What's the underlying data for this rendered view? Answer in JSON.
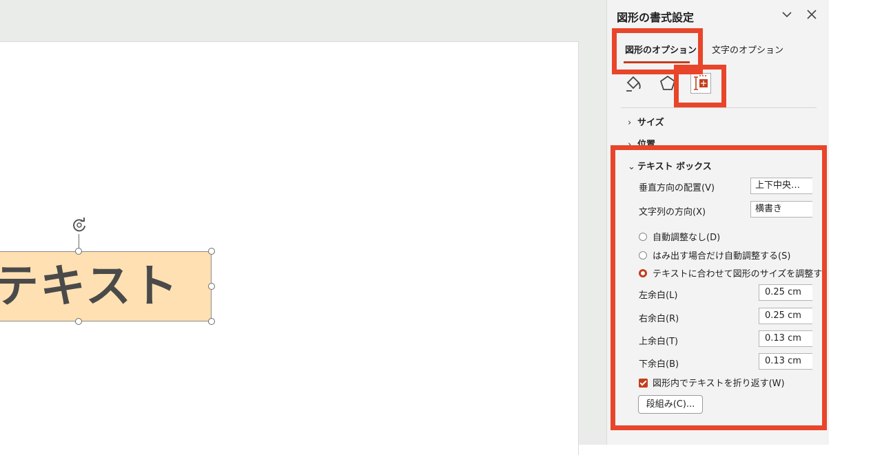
{
  "canvas": {
    "shape_text": "テキスト"
  },
  "panel": {
    "title": "図形の書式設定",
    "tabs": [
      {
        "label": "図形のオプション",
        "active": true
      },
      {
        "label": "文字のオプション",
        "active": false
      }
    ],
    "category_icons": [
      "fill-line-icon",
      "effects-pentagon-icon",
      "size-properties-icon"
    ],
    "sections": {
      "size": "サイズ",
      "position": "位置",
      "textbox": "テキスト ボックス"
    },
    "textbox": {
      "vertical_align_label": "垂直方向の配置(V)",
      "vertical_align_value": "上下中央…",
      "text_direction_label": "文字列の方向(X)",
      "text_direction_value": "横書き",
      "autofit_options": [
        {
          "label": "自動調整なし(D)",
          "selected": false
        },
        {
          "label": "はみ出す場合だけ自動調整する(S)",
          "selected": false
        },
        {
          "label": "テキストに合わせて図形のサイズを調整す",
          "selected": true
        }
      ],
      "margins": [
        {
          "label": "左余白(L)",
          "value": "0.25 cm"
        },
        {
          "label": "右余白(R)",
          "value": "0.25 cm"
        },
        {
          "label": "上余白(T)",
          "value": "0.13 cm"
        },
        {
          "label": "下余白(B)",
          "value": "0.13 cm"
        }
      ],
      "wrap_label": "図形内でテキストを折り返す(W)",
      "wrap_checked": true,
      "columns_button": "段組み(C)..."
    }
  },
  "colors": {
    "accent": "#c43e1c",
    "highlight": "#e8452a",
    "shape_fill": "#ffe0b2"
  }
}
